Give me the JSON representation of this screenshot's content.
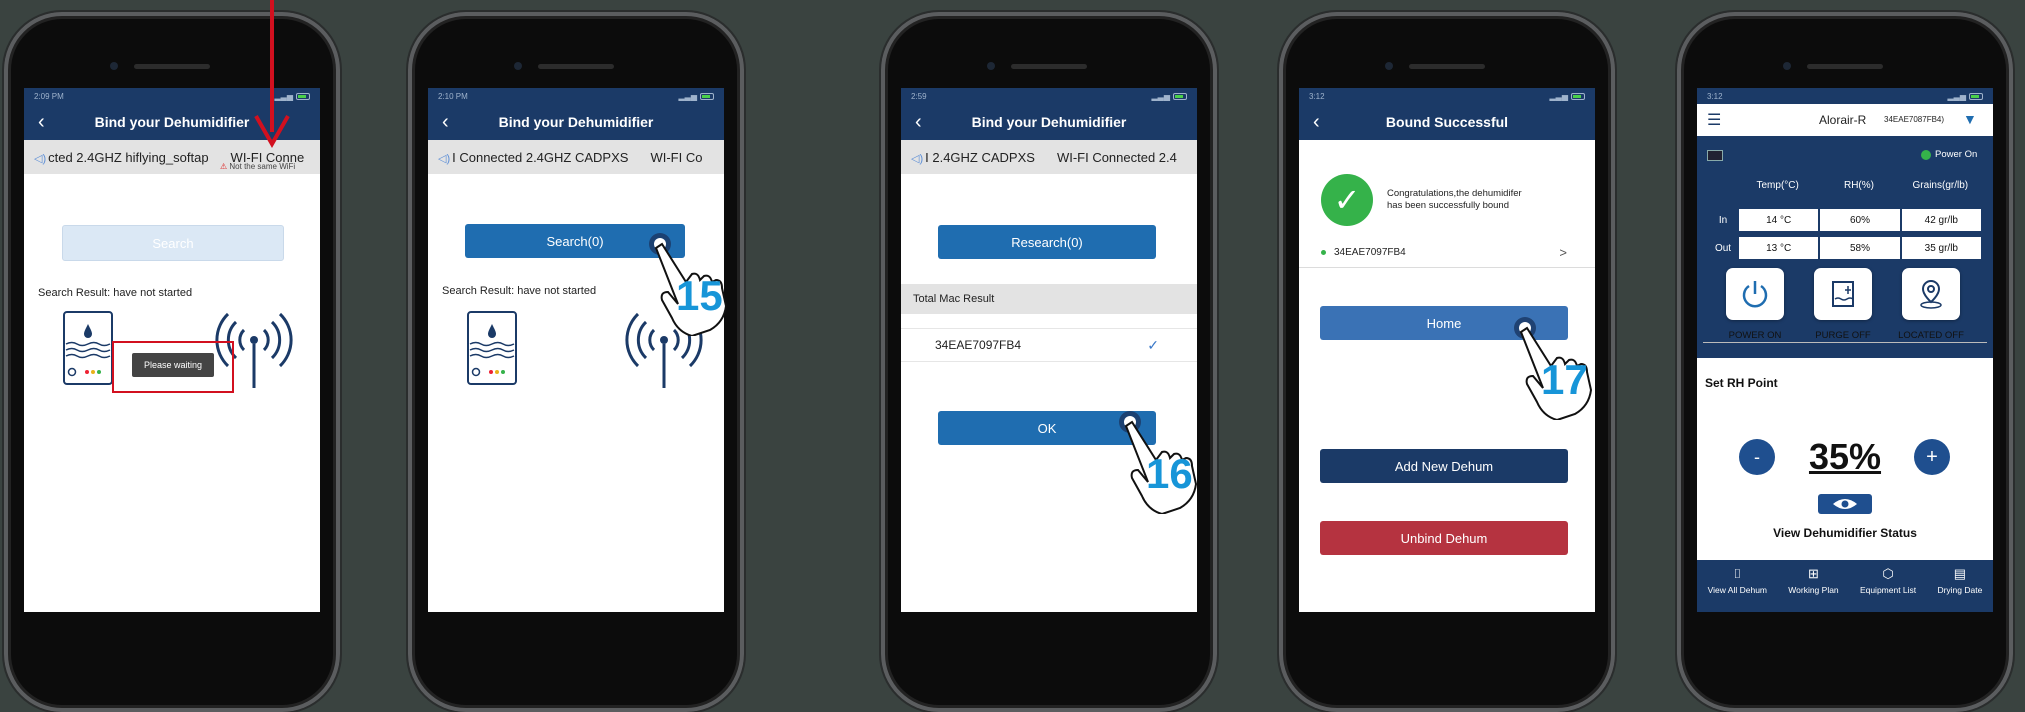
{
  "colors": {
    "navy": "#1b3a67",
    "primary_button": "#1f6db0",
    "danger": "#b53340",
    "success": "#35b24a",
    "step_number": "#1795d8",
    "arrow": "#d2101f"
  },
  "screens": [
    {
      "time": "2:09 PM",
      "title": "Bind your Dehumidifier",
      "wifi_items": [
        "cted 2.4GHZ hiflying_softap",
        "WI-FI Conne"
      ],
      "wifi_warning": "Not the same WiFi",
      "button": "Search",
      "result": "Search Result: have not started",
      "toast": "Please waiting"
    },
    {
      "time": "2:10 PM",
      "title": "Bind your Dehumidifier",
      "wifi_items": [
        "I Connected 2.4GHZ CADPXS",
        "WI-FI Co"
      ],
      "button": "Search(0)",
      "result": "Search Result: have not started",
      "step": "15"
    },
    {
      "time": "2:59",
      "title": "Bind your Dehumidifier",
      "wifi_items": [
        "I 2.4GHZ CADPXS",
        "WI-FI Connected 2.4"
      ],
      "button": "Research(0)",
      "section": "Total Mac Result",
      "mac": "34EAE7097FB4",
      "ok": "OK",
      "step": "16"
    },
    {
      "time": "3:12",
      "title": "Bound Successful",
      "congrats_line1": "Congratulations,the dehumidifer",
      "congrats_line2": "has been successfully bound",
      "device_id": "34EAE7097FB4",
      "home": "Home",
      "add": "Add New Dehum",
      "unbind": "Unbind Dehum",
      "step": "17"
    },
    {
      "time": "3:12",
      "brand": "Alorair-R",
      "device_ref": "34EAE7087FB4)",
      "power_status": "Power On",
      "headers": [
        "Temp(°C)",
        "RH(%)",
        "Grains(gr/lb)"
      ],
      "rows": [
        {
          "label": "In",
          "temp": "14 °C",
          "rh": "60%",
          "grains": "42 gr/lb"
        },
        {
          "label": "Out",
          "temp": "13 °C",
          "rh": "58%",
          "grains": "35 gr/lb"
        }
      ],
      "controls": [
        "POWER ON",
        "PURGE OFF",
        "LOCATED OFF"
      ],
      "set_rh_title": "Set RH Point",
      "minus": "-",
      "plus": "+",
      "rh_value": "35%",
      "view_status": "View Dehumidifier Status",
      "tabs": [
        "View All Dehum",
        "Working Plan",
        "Equipment List",
        "Drying Date"
      ]
    }
  ]
}
